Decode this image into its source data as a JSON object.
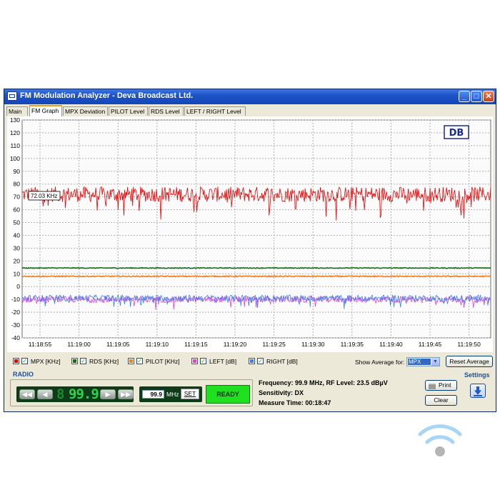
{
  "window": {
    "title": "FM Modulation Analyzer - Deva Broadcast Ltd.",
    "controls": [
      "_",
      "□",
      "✕"
    ]
  },
  "tabs": [
    "Main",
    "FM Graph",
    "MPX Deviation",
    "PILOT Level",
    "RDS Level",
    "LEFT / RIGHT Level"
  ],
  "active_tab": "FM Graph",
  "logo_text": "DB",
  "chart_data": {
    "type": "line",
    "y_ticks": [
      "130",
      "120",
      "110",
      "100",
      "90",
      "80",
      "70",
      "60",
      "50",
      "40",
      "30",
      "20",
      "10",
      "0",
      "-10",
      "-20",
      "-30",
      "-40"
    ],
    "ylim": [
      -40,
      130
    ],
    "x_ticks": [
      "11:18:55",
      "11:19:00",
      "11:19:05",
      "11:19:10",
      "11:19:15",
      "11:19:20",
      "11:19:25",
      "11:19:30",
      "11:19:35",
      "11:19:40",
      "11:19:45",
      "11:19:50"
    ],
    "grid": true,
    "annotation": "72.03 KHz",
    "series": [
      {
        "name": "MPX [KHz]",
        "color": "#ee0000",
        "level": 72,
        "noise": 6
      },
      {
        "name": "RDS [KHz]",
        "color": "#126f12",
        "level": 14.5,
        "noise": 0.3
      },
      {
        "name": "PILOT [KHz]",
        "color": "#f08020",
        "level": 8,
        "noise": 0.4
      },
      {
        "name": "LEFT [dB]",
        "color": "#e040e0",
        "level": -10,
        "noise": 2.5
      },
      {
        "name": "RIGHT [dB]",
        "color": "#3a7ef0",
        "level": -9,
        "noise": 2.5
      }
    ]
  },
  "legend": {
    "items": [
      {
        "label": "MPX [KHz]",
        "color": "#ee0000",
        "checked": "✓"
      },
      {
        "label": "RDS [KHz]",
        "color": "#126f12",
        "checked": "✓"
      },
      {
        "label": "PILOT [KHz]",
        "color": "#f08020",
        "checked": "✓"
      },
      {
        "label": "LEFT [dB]",
        "color": "#e040e0",
        "checked": "✓"
      },
      {
        "label": "RIGHT [dB]",
        "color": "#3a7ef0",
        "checked": "✓"
      }
    ],
    "show_average_label": "Show Average for:",
    "show_average_value": "MPX",
    "reset_label": "Reset Average"
  },
  "radio": {
    "label": "RADIO",
    "nav_icons": [
      "◀◀",
      "◀",
      "▶",
      "▶▶"
    ],
    "display_freq": "99.9",
    "freq_input": "99.9",
    "unit": "MHz",
    "set_label": "SET",
    "status": "READY"
  },
  "info": {
    "line1": "Frequency: 99.9 MHz, RF Level: 23.5 dBµV",
    "line2": "Sensitivity: DX",
    "line3": "Measure Time: 00:18:47"
  },
  "buttons": {
    "print": "Print",
    "clear": "Clear",
    "settings": "Settings"
  }
}
